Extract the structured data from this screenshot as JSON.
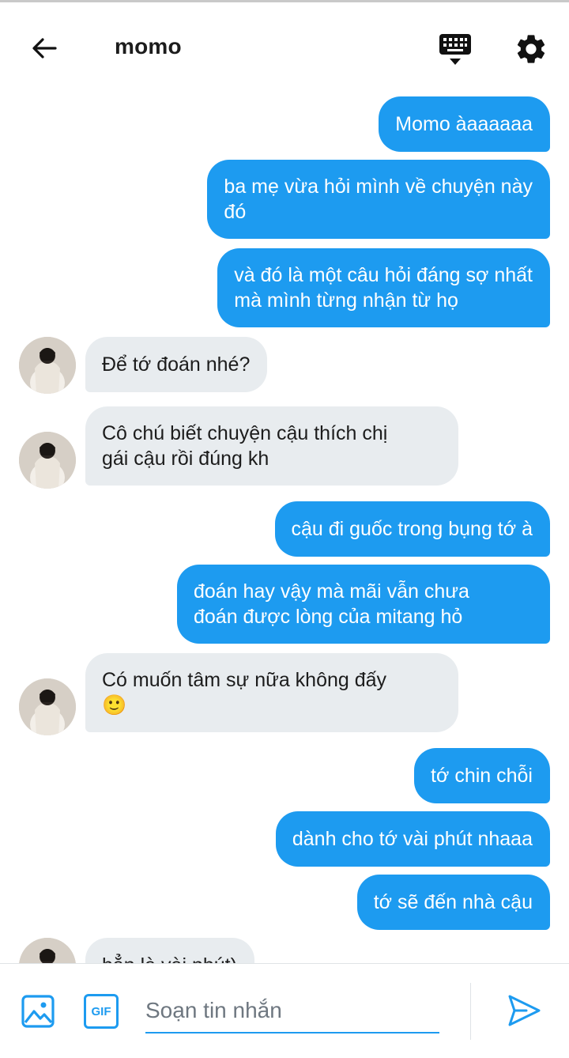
{
  "header": {
    "title": "momo",
    "icons": [
      "back-arrow-icon",
      "keyboard-icon",
      "gear-icon"
    ]
  },
  "messages": [
    {
      "from": "me",
      "text": "Momo àaaaaaa"
    },
    {
      "from": "me",
      "lines": [
        "ba mẹ vừa hỏi mình về chuyện này",
        "đó"
      ]
    },
    {
      "from": "me",
      "lines": [
        "và đó là một câu hỏi đáng sợ nhất",
        "mà mình từng nhận từ họ"
      ]
    },
    {
      "from": "them",
      "text": "Để tớ đoán nhé?"
    },
    {
      "from": "them",
      "lines": [
        "Cô chú biết chuyện cậu thích chị",
        "gái cậu rồi đúng kh"
      ]
    },
    {
      "from": "me",
      "text": "cậu đi guốc trong bụng tớ à"
    },
    {
      "from": "me",
      "lines": [
        "đoán hay vậy mà mãi vẫn chưa",
        "đoán được lòng của mitang hỏ"
      ]
    },
    {
      "from": "them",
      "lines": [
        "Có muốn tâm sự nữa không đấy",
        "🙂"
      ]
    },
    {
      "from": "me",
      "text": "tớ chin chỗi"
    },
    {
      "from": "me",
      "text": "dành cho tớ vài phút nhaaa"
    },
    {
      "from": "me",
      "text": "tớ sẽ đến nhà cậu"
    },
    {
      "from": "them",
      "text": "hẳn là vài phút)"
    }
  ],
  "composer": {
    "gif_label": "GIF",
    "placeholder": "Soạn tin nhắn",
    "value": "",
    "icons": [
      "image-icon",
      "gif-icon",
      "send-icon"
    ]
  },
  "colors": {
    "accent": "#1d9bf0",
    "received_bubble": "#e8ecef",
    "text": "#1c1c1c"
  }
}
